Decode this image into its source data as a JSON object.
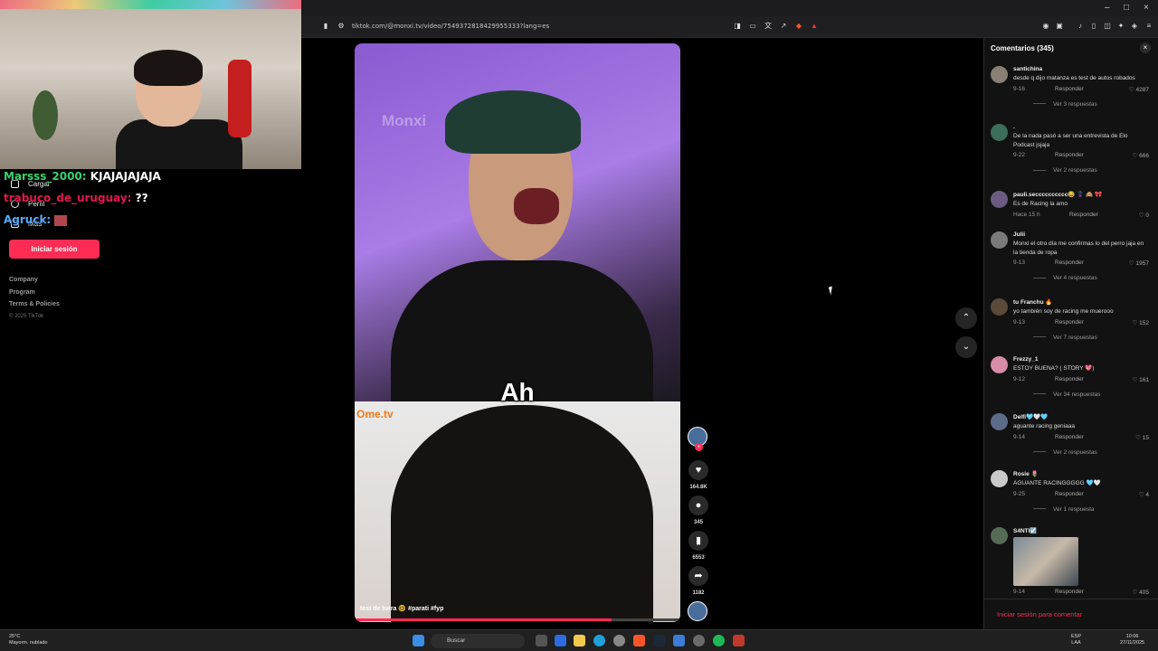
{
  "browser": {
    "url": "tiktok.com/@monxi.tv/video/7549372818429955333?lang=es",
    "window_controls": [
      "–",
      "□",
      "×"
    ]
  },
  "stream_chat": [
    {
      "user": "Marsss_2000:",
      "message": "KJAJAJAJAJA",
      "color": "#3bd16f"
    },
    {
      "user": "trabuco_de_uruguay:",
      "message": "??",
      "color": "#e0194f"
    },
    {
      "user": "Agruck:",
      "message": "",
      "color": "#5aa9ff"
    }
  ],
  "sidebar": {
    "items": [
      {
        "label": "Cargar",
        "icon": "upload-icon"
      },
      {
        "label": "Perfil",
        "icon": "profile-icon"
      },
      {
        "label": "Más",
        "icon": "more-icon"
      }
    ],
    "login_label": "Iniciar sesión",
    "footer_links": [
      "Company",
      "Program",
      "Terms & Policies"
    ],
    "copyright": "© 2025 TikTok"
  },
  "video": {
    "watermark": "Monxi",
    "caption": "Ah",
    "top_left_logo": "Ome.tv",
    "description": "test de turra 🤓 #parati #fyp",
    "progress": 0.79
  },
  "actions": {
    "likes": "164.8K",
    "comments": "345",
    "saves": "6553",
    "shares": "1182"
  },
  "comments_panel": {
    "title": "Comentarios (345)",
    "reply_label": "Responder",
    "login_prompt": "Iniciar sesión para comentar",
    "comments": [
      {
        "user": "santichina",
        "text": "desde q dijo matanza es test de autos robados",
        "date": "9-16",
        "likes": "4287",
        "more": "Ver 3 respuestas",
        "avatar_color": "#8a7f74"
      },
      {
        "user": ".",
        "text": "De la nada pasó a ser una entrevista de Elo Podcast jsjaja",
        "date": "9-22",
        "likes": "666",
        "more": "Ver 2 respuestas",
        "avatar_color": "#3c6e5a"
      },
      {
        "user": "pauli.secccccccccc😂 🦹‍♀️ 🙈 🎀",
        "text": "Es de Racing la amo",
        "date": "Hace 15 h",
        "likes": "0",
        "more": "",
        "avatar_color": "#6a5c80"
      },
      {
        "user": "Julii",
        "text": "Monxi el otro día me confirmas lo del perro jaja en la tienda de ropa",
        "date": "9-13",
        "likes": "1957",
        "more": "Ver 4 respuestas",
        "avatar_color": "#7a7a7a"
      },
      {
        "user": "tu Franchu 🔥",
        "text": "yo también soy de racing me muerooo",
        "date": "9-13",
        "likes": "152",
        "more": "Ver 7 respuestas",
        "avatar_color": "#5a4a3a"
      },
      {
        "user": "Frezzy_1",
        "text": "ESTOY BUENA? ( STORY 💖)",
        "date": "9-12",
        "likes": "161",
        "more": "Ver 34 respuestas",
        "avatar_color": "#d88ca8"
      },
      {
        "user": "Delfi🩵🤍🩵",
        "text": "aguante racing geniaaa",
        "date": "9-14",
        "likes": "15",
        "more": "Ver 2 respuestas",
        "avatar_color": "#5b6c8a"
      },
      {
        "user": "Rosie 🌷",
        "text": "AGUANTE RACINGGGGG 🩵🤍",
        "date": "9-25",
        "likes": "4",
        "more": "Ver 1 respuesta",
        "avatar_color": "#c9c9c9"
      },
      {
        "user": "S4NTI☑️",
        "text": "",
        "date": "9-14",
        "likes": "405",
        "more": "",
        "avatar_color": "#556b55"
      }
    ]
  },
  "taskbar": {
    "temperature": "25°C",
    "weather": "Mayorm. nublado",
    "search_placeholder": "Buscar",
    "lang_top": "ESP",
    "lang_bottom": "LAA",
    "time": "10:06",
    "date": "27/11/2025"
  }
}
